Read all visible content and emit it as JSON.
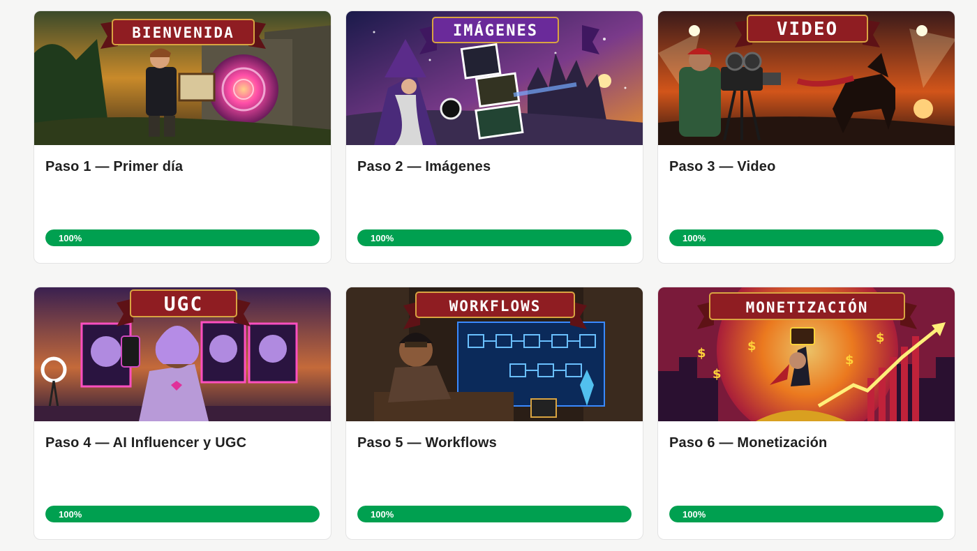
{
  "courses": [
    {
      "banner": "BIENVENIDA",
      "title": "Paso 1 — Primer día",
      "progress": 100,
      "progress_label": "100%",
      "scene": "portal-forest"
    },
    {
      "banner": "IMÁGENES",
      "title": "Paso 2 — Imágenes",
      "progress": 100,
      "progress_label": "100%",
      "scene": "wizard-castle"
    },
    {
      "banner": "VIDEO",
      "title": "Paso 3 — Video",
      "progress": 100,
      "progress_label": "100%",
      "scene": "film-camera"
    },
    {
      "banner": "UGC",
      "title": "Paso 4 — AI Influencer y UGC",
      "progress": 100,
      "progress_label": "100%",
      "scene": "influencer-room"
    },
    {
      "banner": "WORKFLOWS",
      "title": "Paso 5 — Workflows",
      "progress": 100,
      "progress_label": "100%",
      "scene": "workshop-diagram"
    },
    {
      "banner": "MONETIZACIÓN",
      "title": "Paso 6 — Monetización",
      "progress": 100,
      "progress_label": "100%",
      "scene": "money-city"
    }
  ],
  "colors": {
    "progress_fill": "#00a050",
    "progress_track": "#e6e6e6",
    "ribbon": "#8f1d22",
    "ribbon_alt": "#6a2a9a",
    "title_text": "#1f1f1f"
  }
}
